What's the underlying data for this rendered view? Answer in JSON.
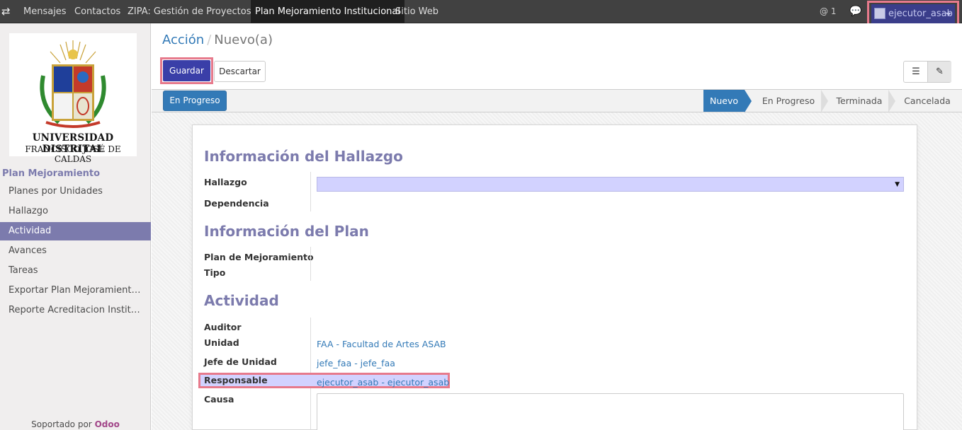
{
  "topbar": {
    "menu": [
      "Mensajes",
      "Contactos",
      "ZIPA: Gestión de Proyectos",
      "Plan Mejoramiento Institucional",
      "Sitio Web"
    ],
    "mentions": "@ 1",
    "user": "ejecutor_asab"
  },
  "annotations": [
    "1",
    "2",
    "3"
  ],
  "sidebar": {
    "logo_line1": "UNIVERSIDAD DISTRITAL",
    "logo_line2": "FRANCISCO JOSÉ DE CALDAS",
    "section": "Plan Mejoramiento",
    "items": [
      "Planes por Unidades",
      "Hallazgo",
      "Actividad",
      "Avances",
      "Tareas",
      "Exportar Plan Mejoramient…",
      "Reporte Acreditacion Instit…"
    ],
    "footer_text": "Soportado por",
    "footer_brand": "Odoo"
  },
  "breadcrumb": {
    "parent": "Acción",
    "separator": "/",
    "current": "Nuevo(a)"
  },
  "buttons": {
    "save": "Guardar",
    "discard": "Descartar",
    "progress": "En Progreso"
  },
  "stages": [
    "Nuevo",
    "En Progreso",
    "Terminada",
    "Cancelada"
  ],
  "form": {
    "sec1": "Información del Hallazgo",
    "hallazgo_label": "Hallazgo",
    "dependencia_label": "Dependencia",
    "sec2": "Información del Plan",
    "plan_label": "Plan de Mejoramiento",
    "tipo_label": "Tipo",
    "sec3": "Actividad",
    "auditor_label": "Auditor",
    "unidad_label": "Unidad",
    "unidad_value": "FAA - Facultad de Artes ASAB",
    "jefe_label": "Jefe de Unidad",
    "jefe_value": "jefe_faa - jefe_faa",
    "responsable_label": "Responsable",
    "responsable_value": "ejecutor_asab - ejecutor_asab",
    "causa_label": "Causa"
  },
  "colors": {
    "accent": "#7c7bad",
    "primary": "#337ab7",
    "highlight": "#e77a8c"
  }
}
